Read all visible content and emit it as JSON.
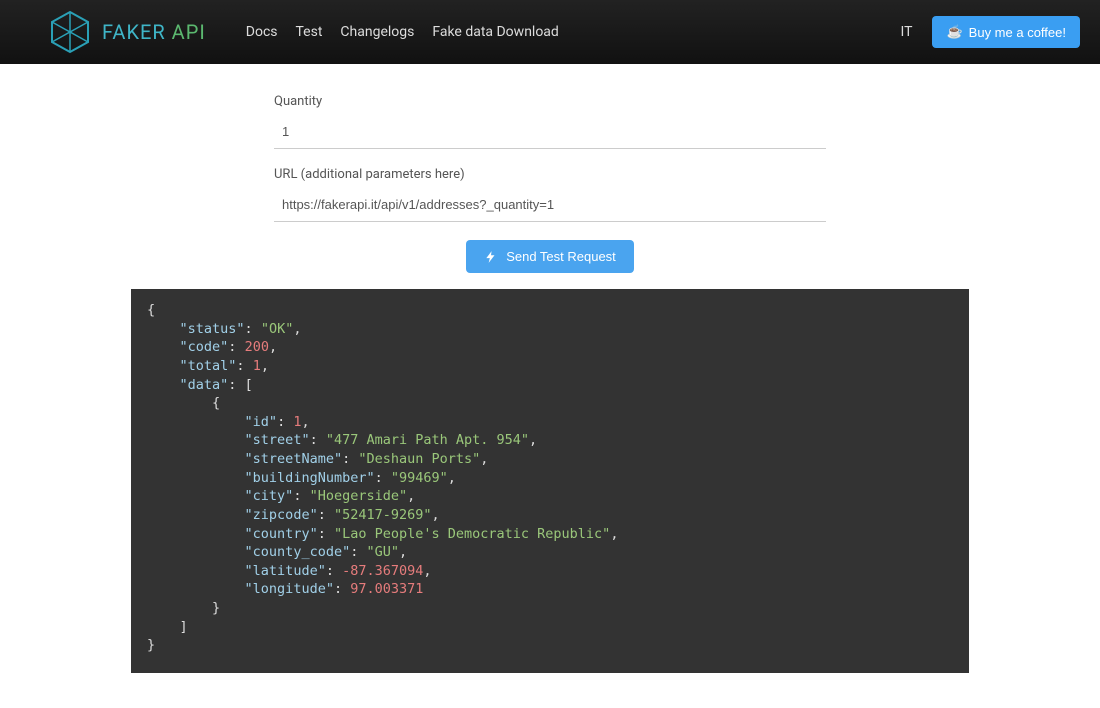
{
  "brand": {
    "faker": "FAKER",
    "api": "API"
  },
  "nav": {
    "docs": "Docs",
    "test": "Test",
    "changelogs": "Changelogs",
    "fakedata": "Fake data Download"
  },
  "lang": "IT",
  "coffee": "Buy me a coffee!",
  "form": {
    "quantity_label": "Quantity",
    "quantity_value": "1",
    "url_label": "URL (additional parameters here)",
    "url_value": "https://fakerapi.it/api/v1/addresses?_quantity=1",
    "send_button": "Send Test Request"
  },
  "response": {
    "status": "OK",
    "code": 200,
    "total": 1,
    "data": [
      {
        "id": 1,
        "street": "477 Amari Path Apt. 954",
        "streetName": "Deshaun Ports",
        "buildingNumber": "99469",
        "city": "Hoegerside",
        "zipcode": "52417-9269",
        "country": "Lao People's Democratic Republic",
        "county_code": "GU",
        "latitude": -87.367094,
        "longitude": 97.003371
      }
    ]
  },
  "colors": {
    "accent": "#3a9ef2",
    "code_bg": "#333333",
    "code_key": "#a1d0e8",
    "code_str": "#9ac77a",
    "code_num": "#e67c7c"
  },
  "chart_data": null
}
